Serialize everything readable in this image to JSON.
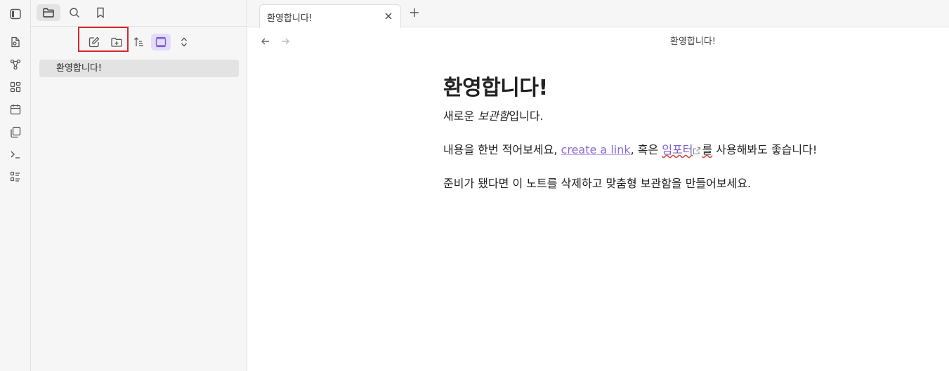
{
  "app": {
    "ribbon": {
      "icons": [
        "random-note-icon",
        "graph-view-icon",
        "canvas-icon",
        "daily-note-icon",
        "templates-icon",
        "command-palette-icon",
        "slides-icon"
      ]
    },
    "sidebar": {
      "tabs": [
        "files-icon",
        "search-icon",
        "bookmarks-icon"
      ],
      "nav_buttons": [
        "new-note-icon",
        "new-folder-icon",
        "sort-icon",
        "auto-reveal-icon",
        "collapse-all-icon"
      ],
      "files": [
        {
          "name": "환영합니다!"
        }
      ]
    },
    "tab": {
      "title": "환영합니다!",
      "view_title": "환영합니다!"
    },
    "note": {
      "heading": "환영합니다!",
      "line1_prefix": "새로운 ",
      "line1_em": "보관함",
      "line1_suffix": "입니다.",
      "line2_prefix": "내용을 한번 적어보세요, ",
      "line2_link": "create a link",
      "line2_mid": ", 혹은 ",
      "line2_ext": "임포터",
      "line2_suffix_word": "를",
      "line2_suffix": " 사용해봐도 좋습니다!",
      "line3": "준비가 됐다면 이 노트를 삭제하고 맞춤형 보관함을 만들어보세요."
    },
    "colors": {
      "accent": "#8a6bd6",
      "highlight_border": "#d7262f",
      "active_nav_bg": "#e5dcfb"
    }
  }
}
